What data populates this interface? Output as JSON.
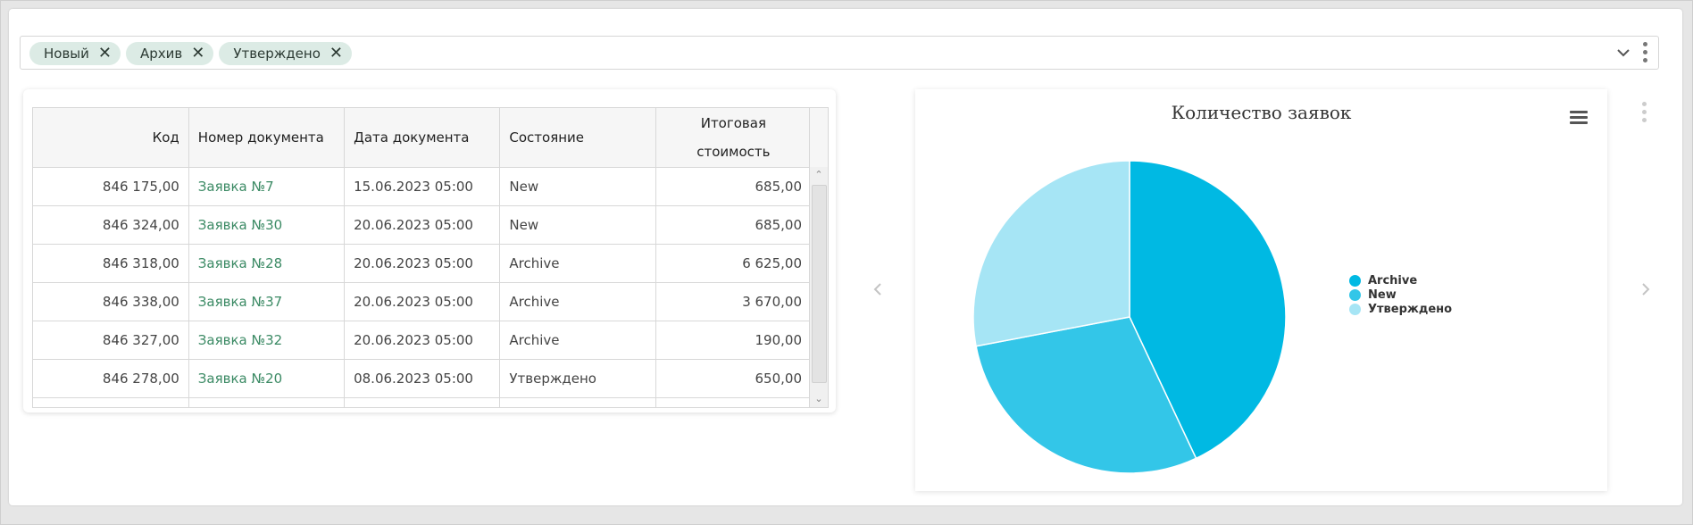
{
  "filters": {
    "chips": [
      {
        "label": "Новый"
      },
      {
        "label": "Архив"
      },
      {
        "label": "Утверждено"
      }
    ]
  },
  "table": {
    "columns": [
      "Код",
      "Номер документа",
      "Дата документа",
      "Состояние",
      "Итоговая стоимость"
    ],
    "rows": [
      {
        "code": "846 175,00",
        "doc": "Заявка №7",
        "date": "15.06.2023 05:00",
        "state": "New",
        "total": "685,00"
      },
      {
        "code": "846 324,00",
        "doc": "Заявка №30",
        "date": "20.06.2023 05:00",
        "state": "New",
        "total": "685,00"
      },
      {
        "code": "846 318,00",
        "doc": "Заявка №28",
        "date": "20.06.2023 05:00",
        "state": "Archive",
        "total": "6 625,00"
      },
      {
        "code": "846 338,00",
        "doc": "Заявка №37",
        "date": "20.06.2023 05:00",
        "state": "Archive",
        "total": "3 670,00"
      },
      {
        "code": "846 327,00",
        "doc": "Заявка №32",
        "date": "20.06.2023 05:00",
        "state": "Archive",
        "total": "190,00"
      },
      {
        "code": "846 278,00",
        "doc": "Заявка №20",
        "date": "08.06.2023 05:00",
        "state": "Утверждено",
        "total": "650,00"
      }
    ]
  },
  "chart_data": {
    "type": "pie",
    "title": "Количество заявок",
    "categories": [
      "Archive",
      "New",
      "Утверждено"
    ],
    "values": [
      43,
      29,
      28
    ],
    "colors": [
      "#00b9e3",
      "#33c6e8",
      "#a6e5f5"
    ],
    "legend_position": "right"
  },
  "icons": {
    "chip_remove": "close-icon",
    "dropdown": "chevron-down-icon",
    "menu": "kebab-menu-icon",
    "chart_menu": "hamburger-menu-icon",
    "prev": "chevron-left-icon",
    "next": "chevron-right-icon"
  }
}
